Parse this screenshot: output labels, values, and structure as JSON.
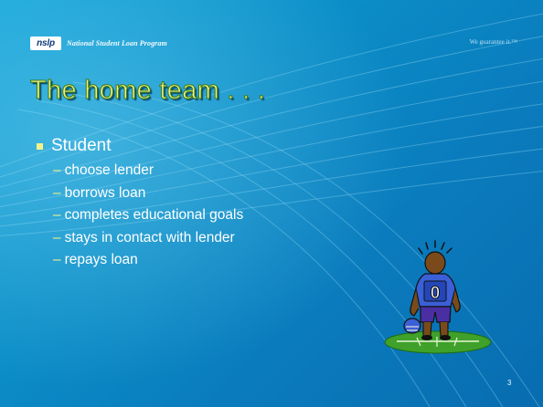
{
  "header": {
    "logo_badge": "nslp",
    "organization": "National Student Loan Program",
    "tagline": "We guarantee it.™"
  },
  "slide": {
    "title": "The home team . . .",
    "bullet": "Student",
    "subitems": [
      "choose lender",
      "borrows loan",
      "completes educational goals",
      "stays in contact with lender",
      "repays loan"
    ],
    "page_number": "3",
    "clipart": {
      "jersey_number": "0",
      "jersey_color": "#3b5fd6",
      "field_color": "#3fa12a"
    }
  },
  "colors": {
    "background": "#0b8fc8",
    "title": "#f2f28a",
    "accent": "#f2f28a",
    "text": "#ffffff"
  }
}
